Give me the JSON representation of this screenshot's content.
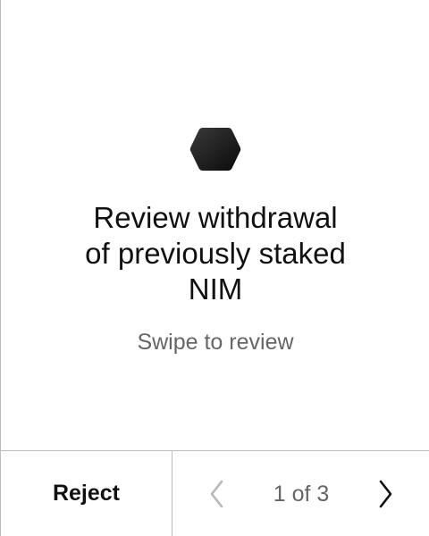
{
  "review": {
    "icon": "hexagon-icon",
    "title_line1": "Review withdrawal",
    "title_line2": "of previously staked",
    "title_line3": "NIM",
    "subtitle": "Swipe to review"
  },
  "actions": {
    "reject_label": "Reject"
  },
  "pager": {
    "prev_icon": "chevron-left-icon",
    "next_icon": "chevron-right-icon",
    "indicator": "1 of 3",
    "current_page": 1,
    "total_pages": 3
  },
  "colors": {
    "text": "#111111",
    "muted": "#666666",
    "divider": "#bdbdbd",
    "hexagon": "#1a1a1a"
  }
}
